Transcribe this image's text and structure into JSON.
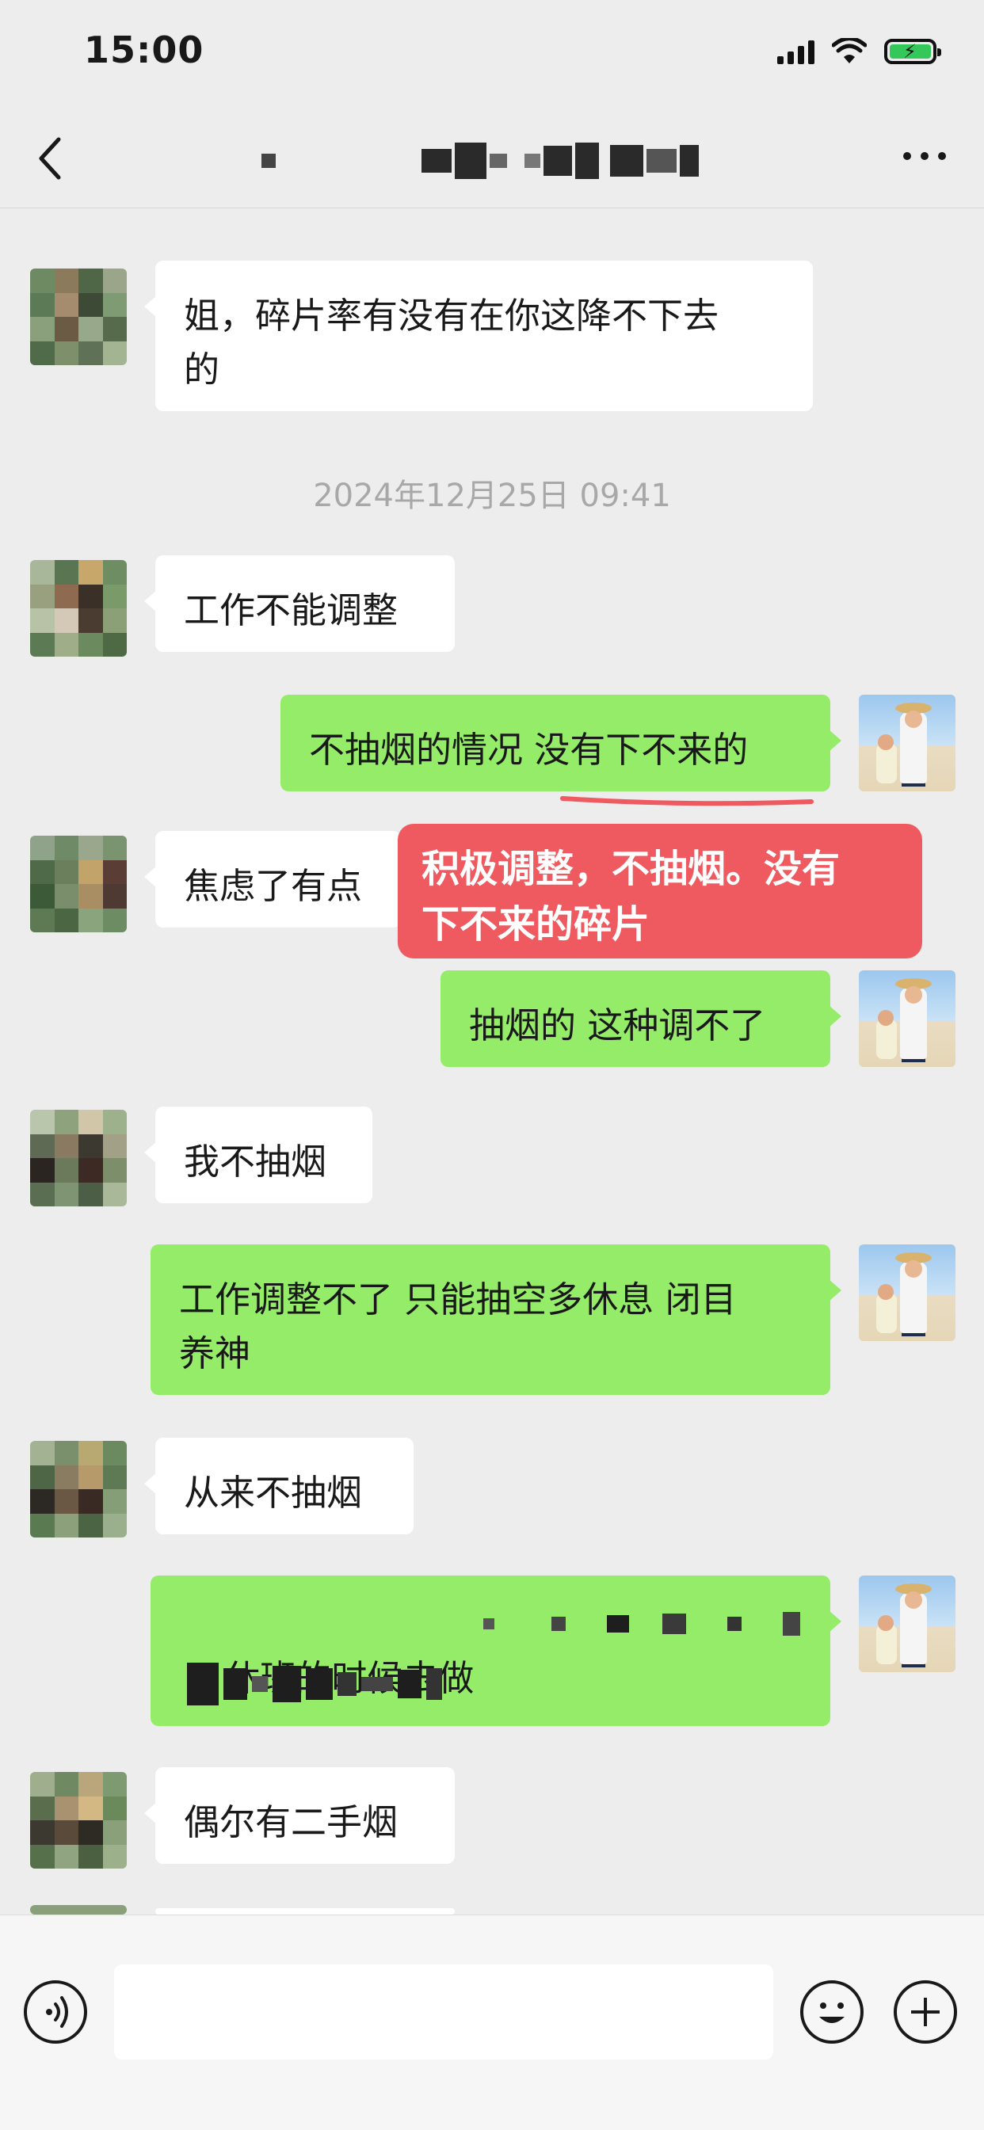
{
  "status_bar": {
    "time": "15:00"
  },
  "nav": {
    "back_label": "‹",
    "title": ""
  },
  "chat": {
    "messages": [
      {
        "side": "other",
        "text": "姐，碎片率有没有在你这降不下去\n的"
      },
      {
        "timestamp": "2024年12月25日 09:41"
      },
      {
        "side": "other",
        "text": "工作不能调整"
      },
      {
        "side": "self",
        "text": "不抽烟的情况 没有下不来的"
      },
      {
        "side": "other",
        "text": "焦虑了有点"
      },
      {
        "side": "self",
        "text": "抽烟的 这种调不了"
      },
      {
        "side": "other",
        "text": "我不抽烟"
      },
      {
        "side": "self",
        "text": "工作调整不了 只能抽空多休息 闭目\n养神"
      },
      {
        "side": "other",
        "text": "从来不抽烟"
      },
      {
        "side": "self",
        "text": "休班的时候去做"
      },
      {
        "side": "other",
        "text": "偶尔有二手烟"
      }
    ]
  },
  "annotation": {
    "text": "积极调整，不抽烟。没有\n下不来的碎片",
    "color": "#ee5a5f"
  },
  "colors": {
    "self_bubble": "#95ec69",
    "other_bubble": "#ffffff",
    "background": "#ededed"
  },
  "input_bar": {
    "voice": "voice-icon",
    "emoji": "emoji-icon",
    "more": "plus-icon"
  }
}
